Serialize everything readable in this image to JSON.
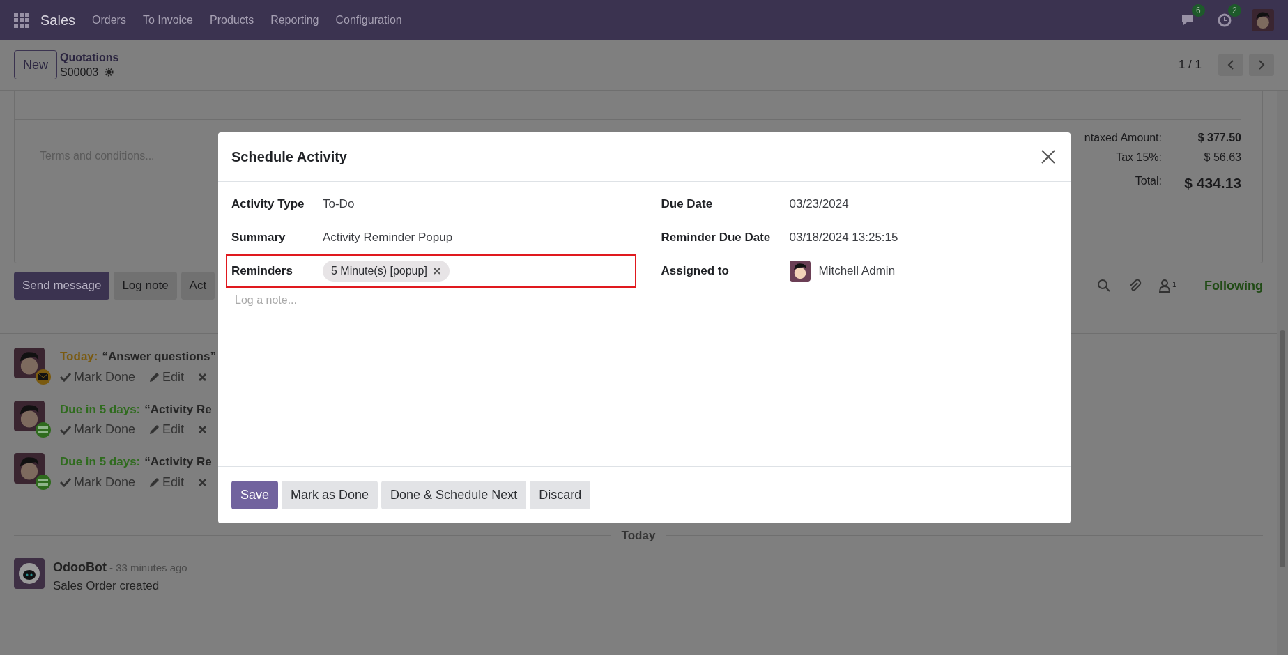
{
  "navbar": {
    "app": "Sales",
    "menu": [
      "Orders",
      "To Invoice",
      "Products",
      "Reporting",
      "Configuration"
    ],
    "messages_count": "6",
    "activities_count": "2"
  },
  "control_panel": {
    "new_button": "New",
    "breadcrumb": "Quotations",
    "record": "S00003",
    "pager": "1 / 1"
  },
  "form": {
    "terms_placeholder": "Terms and conditions...",
    "totals": [
      {
        "label": "ntaxed Amount:",
        "value": "$ 377.50",
        "kind": "bold"
      },
      {
        "label": "Tax 15%:",
        "value": "$ 56.63",
        "kind": "plain"
      },
      {
        "label": "Total:",
        "value": "$ 434.13",
        "kind": "total"
      }
    ]
  },
  "chatter": {
    "buttons": [
      {
        "label": "Send message",
        "selected": true
      },
      {
        "label": "Log note",
        "selected": false
      },
      {
        "label": "Act",
        "selected": false
      }
    ],
    "followers_count": "1",
    "following": "Following",
    "activities": [
      {
        "due": "Today:",
        "summary": "“Answer questions”",
        "kind": "email",
        "color": "#7a5a10",
        "actions": [
          "Mark Done",
          "Edit"
        ]
      },
      {
        "due": "Due in 5 days:",
        "summary": "“Activity Re",
        "kind": "todo",
        "color": "#2f6b1e",
        "actions": [
          "Mark Done",
          "Edit"
        ]
      },
      {
        "due": "Due in 5 days:",
        "summary": "“Activity Re",
        "kind": "todo",
        "color": "#2f6b1e",
        "actions": [
          "Mark Done",
          "Edit"
        ]
      }
    ],
    "separator": "Today",
    "message": {
      "author": "OdooBot",
      "time": "- 33 minutes ago",
      "body": "Sales Order created"
    }
  },
  "dialog": {
    "title": "Schedule Activity",
    "left_fields": [
      {
        "label": "Activity Type",
        "value": "To-Do",
        "kind": "text"
      },
      {
        "label": "Summary",
        "value": "Activity Reminder Popup",
        "kind": "text"
      },
      {
        "label": "Reminders",
        "value": "5 Minute(s) [popup]",
        "kind": "tag",
        "highlighted": true
      }
    ],
    "right_fields": [
      {
        "label": "Due Date",
        "value": "03/23/2024",
        "kind": "text"
      },
      {
        "label": "Reminder Due Date",
        "value": "03/18/2024 13:25:15",
        "kind": "text"
      },
      {
        "label": "Assigned to",
        "value": "Mitchell Admin",
        "kind": "user"
      }
    ],
    "note_placeholder": "Log a note...",
    "buttons": [
      {
        "label": "Save",
        "kind": "primary"
      },
      {
        "label": "Mark as Done",
        "kind": "secondary"
      },
      {
        "label": "Done & Schedule Next",
        "kind": "secondary"
      },
      {
        "label": "Discard",
        "kind": "secondary"
      }
    ]
  }
}
